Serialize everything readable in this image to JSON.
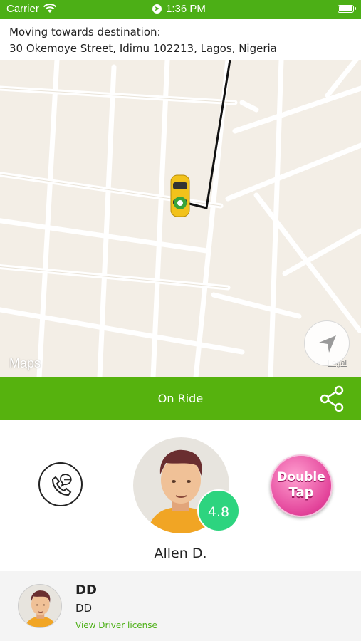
{
  "status_bar": {
    "carrier": "Carrier",
    "time": "1:36 PM"
  },
  "destination": {
    "line1": "Moving towards destination:",
    "line2": "30 Okemoye Street, Idimu 102213, Lagos, Nigeria"
  },
  "map": {
    "brand": "Maps",
    "legal": "Legal"
  },
  "ride_bar": {
    "label": "On Ride",
    "color": "#56b20e"
  },
  "driver": {
    "name": "Allen D.",
    "rating": "4.8",
    "badge_line1": "Double",
    "badge_line2": "Tap"
  },
  "vehicle_card": {
    "title": "DD",
    "subtitle": "DD",
    "link": "View Driver license"
  },
  "icons": [
    "wifi-icon",
    "location-arrow-icon",
    "battery-icon",
    "apple-icon",
    "navigate-icon",
    "car-icon",
    "share-icon",
    "phone-chat-icon"
  ]
}
